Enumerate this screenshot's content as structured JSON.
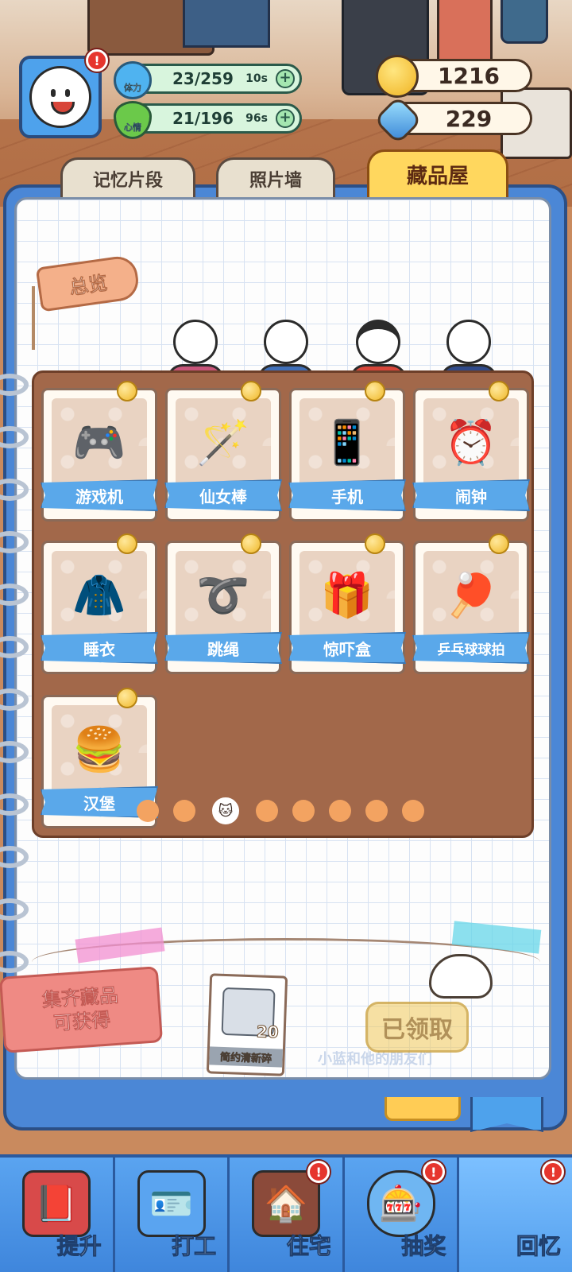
{
  "hud": {
    "stamina": {
      "label": "体力",
      "value": "23/259",
      "timer": "10s",
      "color": "#4fb3f0"
    },
    "mood": {
      "label": "心情",
      "value": "21/196",
      "timer": "96s",
      "color": "#6bc94a"
    },
    "coins": "1216",
    "gems": "229",
    "plus": "+",
    "alert": "!"
  },
  "tabs": [
    {
      "label": "记忆片段",
      "active": false
    },
    {
      "label": "照片墙",
      "active": false
    },
    {
      "label": "藏品屋",
      "active": true
    }
  ],
  "overview_tag": "总览",
  "collection": {
    "items": [
      {
        "name": "游戏机",
        "icon": "game-console-icon",
        "glyph": "🎮"
      },
      {
        "name": "仙女棒",
        "icon": "magic-wand-icon",
        "glyph": "🪄"
      },
      {
        "name": "手机",
        "icon": "phone-icon",
        "glyph": "📱"
      },
      {
        "name": "闹钟",
        "icon": "alarm-clock-icon",
        "glyph": "⏰"
      },
      {
        "name": "睡衣",
        "icon": "pajamas-icon",
        "glyph": "🧥"
      },
      {
        "name": "跳绳",
        "icon": "jump-rope-icon",
        "glyph": "➰"
      },
      {
        "name": "惊吓盒",
        "icon": "surprise-box-icon",
        "glyph": "🎁"
      },
      {
        "name": "乒乓球球拍",
        "icon": "ping-pong-paddle-icon",
        "glyph": "🏓"
      },
      {
        "name": "汉堡",
        "icon": "burger-icon",
        "glyph": "🍔"
      }
    ],
    "pagination": {
      "total": 8,
      "current": 3
    }
  },
  "reward": {
    "sign_line1": "集齐藏品",
    "sign_line2": "可获得",
    "item_count": "20",
    "item_name": "简约清新碎",
    "claim_status": "已领取",
    "watermark": "小蓝和他的朋友们"
  },
  "nav": [
    {
      "label": "提升",
      "icon": "upgrade-book-icon",
      "glyph": "📕",
      "alert": false
    },
    {
      "label": "打工",
      "icon": "work-badge-icon",
      "glyph": "🪪",
      "alert": false
    },
    {
      "label": "住宅",
      "icon": "house-icon",
      "glyph": "🏠",
      "alert": true
    },
    {
      "label": "抽奖",
      "icon": "gacha-machine-icon",
      "glyph": "🎰",
      "alert": true
    },
    {
      "label": "回忆",
      "icon": "memory-icon",
      "glyph": "",
      "alert": true
    }
  ],
  "colors": {
    "accent_blue": "#4ea2ec",
    "board_brown": "#a2684a",
    "ribbon_blue": "#5aa8ea",
    "active_tab": "#ffd75e",
    "alert_red": "#e6352d"
  }
}
